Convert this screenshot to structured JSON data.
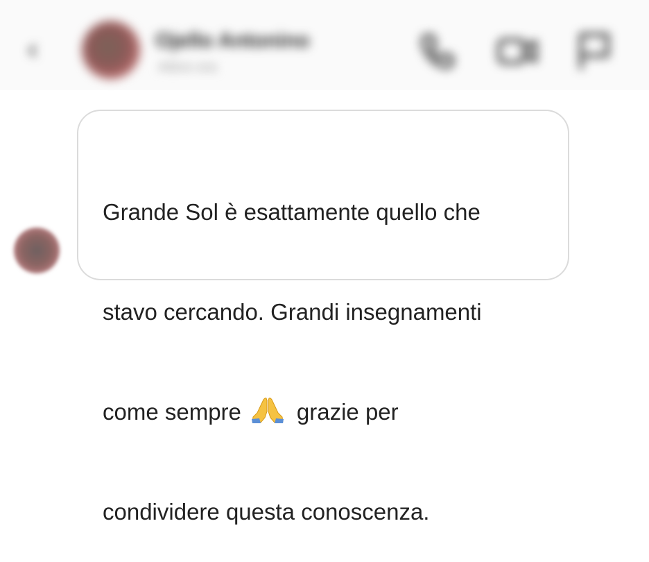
{
  "header": {
    "back_icon": "chevron-left-icon",
    "contact_name": "Ojello Antonino",
    "contact_status": "Attivo ora",
    "actions": [
      {
        "icon": "phone-icon"
      },
      {
        "icon": "video-camera-icon"
      },
      {
        "icon": "flag-icon"
      }
    ]
  },
  "message": {
    "lines": [
      "Grande Sol è esattamente quello che",
      "stavo cercando. Grandi insegnamenti",
      "come sempre",
      "grazie per",
      "condividere questa conoscenza."
    ],
    "emoji": "praying-hands-icon",
    "bubble_border_color": "#dbdbdb",
    "text_color": "#222222"
  }
}
